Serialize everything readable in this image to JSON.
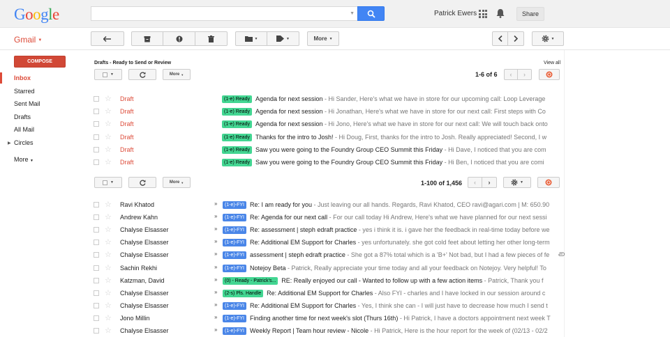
{
  "header": {
    "logo_letters": [
      {
        "ch": "G",
        "color": "#4285f4"
      },
      {
        "ch": "o",
        "color": "#ea4335"
      },
      {
        "ch": "o",
        "color": "#fbbc05"
      },
      {
        "ch": "g",
        "color": "#4285f4"
      },
      {
        "ch": "l",
        "color": "#34a853"
      },
      {
        "ch": "e",
        "color": "#ea4335"
      }
    ],
    "search_value": "",
    "user_name": "Patrick Ewers",
    "share_label": "Share"
  },
  "gmail": {
    "label": "Gmail"
  },
  "toolbar": {
    "more_label": "More"
  },
  "sidebar": {
    "compose_label": "COMPOSE",
    "items": [
      {
        "label": "Inbox",
        "active": true
      },
      {
        "label": "Starred"
      },
      {
        "label": "Sent Mail"
      },
      {
        "label": "Drafts"
      },
      {
        "label": "All Mail"
      },
      {
        "label": "Circles"
      },
      {
        "label": "More"
      }
    ]
  },
  "drafts_section": {
    "title": "Drafts - Ready to Send or Review",
    "view_all": "View all",
    "more_label": "More",
    "pager": "1-6 of 6",
    "rows": [
      {
        "sender": "Draft",
        "label": "(1-e) Ready",
        "subject": "Agenda for next session",
        "snippet": " - Hi Sander, Here's what we have in store for our upcoming call: Loop Leverage"
      },
      {
        "sender": "Draft",
        "label": "(1-e) Ready",
        "subject": "Agenda for next session",
        "snippet": " - Hi Jonathan, Here's what we have in store for our next call: First steps with Co"
      },
      {
        "sender": "Draft",
        "label": "(1-e) Ready",
        "subject": "Agenda for next session",
        "snippet": " - Hi Jono, Here's what we have in store for our next call: We will touch back onto"
      },
      {
        "sender": "Draft",
        "label": "(1-e) Ready",
        "subject": "Thanks for the intro to Josh!",
        "snippet": " - Hi Doug, First, thanks for the intro to Josh. Really appreciated! Second, I w"
      },
      {
        "sender": "Draft",
        "label": "(1-e) Ready",
        "subject": "Saw you were going to the Foundry Group CEO Summit this Friday",
        "snippet": " - Hi Dave, I noticed that you are com"
      },
      {
        "sender": "Draft",
        "label": "(1-e) Ready",
        "subject": "Saw you were going to the Foundry Group CEO Summit this Friday",
        "snippet": " - Hi Ben, I noticed that you are comi"
      }
    ]
  },
  "inbox_section": {
    "more_label": "More",
    "pager": "1-100 of 1,456",
    "rows": [
      {
        "sender": "Ravi Khatod",
        "label": "(1-e)-FYI",
        "label_color": "blue",
        "subject": "Re: I am ready for you",
        "snippet": " - Just leaving our all hands. Regards, Ravi Khatod, CEO ravi@agari.com | M: 650.90"
      },
      {
        "sender": "Andrew Kahn",
        "label": "(1-e)-FYI",
        "label_color": "blue",
        "subject": "Re: Agenda for our next call",
        "snippet": " - For our call today Hi Andrew, Here's what we have planned for our next sessi"
      },
      {
        "sender": "Chalyse Elsasser",
        "label": "(1-e)-FYI",
        "label_color": "blue",
        "subject": "Re: assessment | steph edraft practice",
        "snippet": " - yes i think it is. i gave her the feedback in real-time today before we"
      },
      {
        "sender": "Chalyse Elsasser",
        "label": "(1-e)-FYI",
        "label_color": "blue",
        "subject": "Re: Additional EM Support for Charles",
        "snippet": " - yes unfortunately. she got cold feet about letting her other long-term"
      },
      {
        "sender": "Chalyse Elsasser",
        "label": "(1-e)-FYI",
        "label_color": "blue",
        "subject": "assessment | steph edraft practice",
        "snippet": " - She got a 87% total which is a 'B+' Not bad, but I had a few pieces of fe"
      },
      {
        "sender": "Sachin Rekhi",
        "label": "(1-e)-FYI",
        "label_color": "blue",
        "subject": "Notejoy Beta",
        "snippet": " - Patrick, Really appreciate your time today and all your feedback on Notejoy. Very helpful! To"
      },
      {
        "sender": "Katzman, David",
        "label": "(0) - Ready - Patrick's...",
        "label_color": "green-dark",
        "subject": "RE: Really enjoyed our call - Wanted to follow up with a few action items",
        "snippet": " - Patrick, Thank you f"
      },
      {
        "sender": "Chalyse Elsasser",
        "label": "(2-s) Pls. Handle",
        "label_color": "green-dark",
        "subject": "Re: Additional EM Support for Charles",
        "snippet": " - Also FYI - charles and I have locked in our session around c"
      },
      {
        "sender": "Chalyse Elsasser",
        "label": "(1-e)-FYI",
        "label_color": "blue",
        "subject": "Re: Additional EM Support for Charles",
        "snippet": " - Yes, I think she can - I will just have to decrease how much I send t"
      },
      {
        "sender": "Jono Millin",
        "label": "(1-e)-FYI",
        "label_color": "blue",
        "subject": "Finding another time for next week's slot (Thurs 16th)",
        "snippet": " - Hi Patrick, I have a doctors appointment next week T"
      },
      {
        "sender": "Chalyse Elsasser",
        "label": "(1-e)-FYI",
        "label_color": "blue",
        "subject": "Weekly Report | Team hour review - Nicole",
        "snippet": " - Hi Patrick, Here is the hour report for the week of (02/13 - 02/2"
      }
    ]
  }
}
